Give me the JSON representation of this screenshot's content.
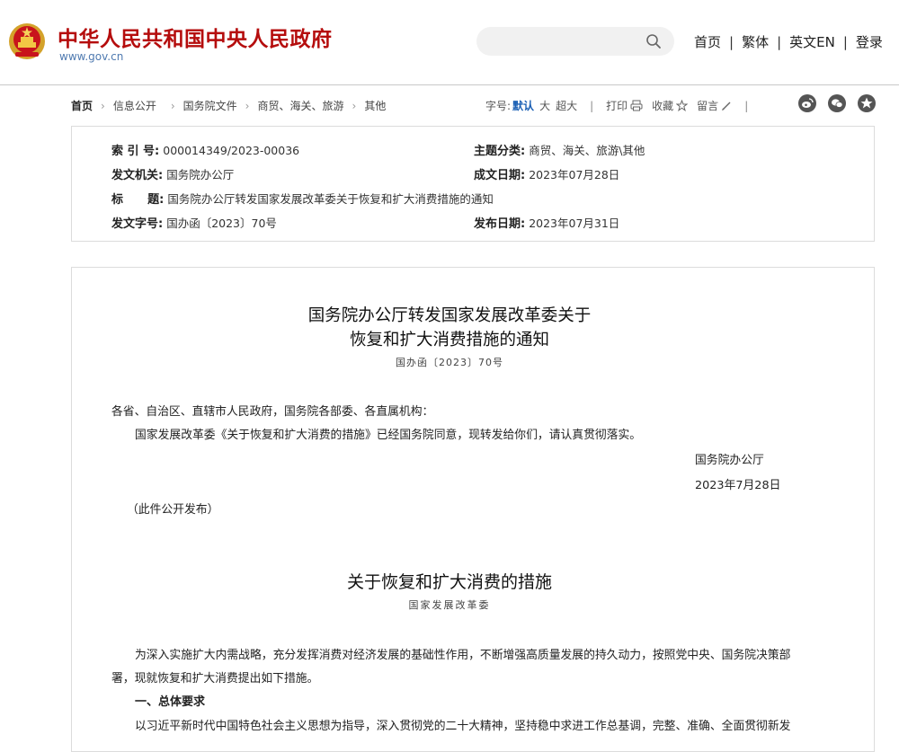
{
  "header": {
    "site_name": "中华人民共和国中央人民政府",
    "site_url": "www.gov.cn",
    "search": {
      "placeholder": "",
      "icon": "search-icon"
    },
    "nav": [
      "首页",
      "繁体",
      "英文EN",
      "登录"
    ],
    "separator": "|",
    "colors": {
      "brand_red": "#b50d0d",
      "url_blue": "#4f7ab0"
    }
  },
  "breadcrumb": {
    "items": [
      "首页",
      "信息公开",
      "国务院文件",
      "商贸、海关、旅游",
      "其他"
    ],
    "arrow": "›"
  },
  "toolbar": {
    "font_label": "字号:",
    "font_default": "默认",
    "font_large": "大",
    "font_xlarge": "超大",
    "bar": "|",
    "print": "打印",
    "favorite": "收藏",
    "comment": "留言",
    "social_icons": [
      "weibo-icon",
      "wechat-icon",
      "qzone-icon"
    ]
  },
  "meta": {
    "index_label": "索 引 号:",
    "index_value": "000014349/2023-00036",
    "topic_label": "主题分类:",
    "topic_value": "商贸、海关、旅游\\其他",
    "issuer_label": "发文机关:",
    "issuer_value": "国务院办公厅",
    "date_written_label": "成文日期:",
    "date_written_value": "2023年07月28日",
    "title_label": "标      题:",
    "title_value": "国务院办公厅转发国家发展改革委关于恢复和扩大消费措施的通知",
    "doc_no_label": "发文字号:",
    "doc_no_value": "国办函〔2023〕70号",
    "pub_date_label": "发布日期:",
    "pub_date_value": "2023年07月31日"
  },
  "article": {
    "title_line1": "国务院办公厅转发国家发展改革委关于",
    "title_line2": "恢复和扩大消费措施的通知",
    "doc_no": "国办函〔2023〕70号",
    "addressee": "各省、自治区、直辖市人民政府，国务院各部委、各直属机构：",
    "body1": "国家发展改革委《关于恢复和扩大消费的措施》已经国务院同意，现转发给你们，请认真贯彻落实。",
    "signer": "国务院办公厅",
    "sign_date": "2023年7月28日",
    "public_note": "（此件公开发布）",
    "sub_title": "关于恢复和扩大消费的措施",
    "sub_author": "国家发展改革委",
    "para1_line1": "为深入实施扩大内需战略，充分发挥消费对经济发展的基础性作用，不断增强高质量发展的持久动力，按照党中央、国务院决策部",
    "para1_line2": "署，现就恢复和扩大消费提出如下措施。",
    "section1": "一、总体要求",
    "para2_line1": "以习近平新时代中国特色社会主义思想为指导，深入贯彻党的二十大精神，坚持稳中求进工作总基调，完整、准确、全面贯彻新发"
  }
}
